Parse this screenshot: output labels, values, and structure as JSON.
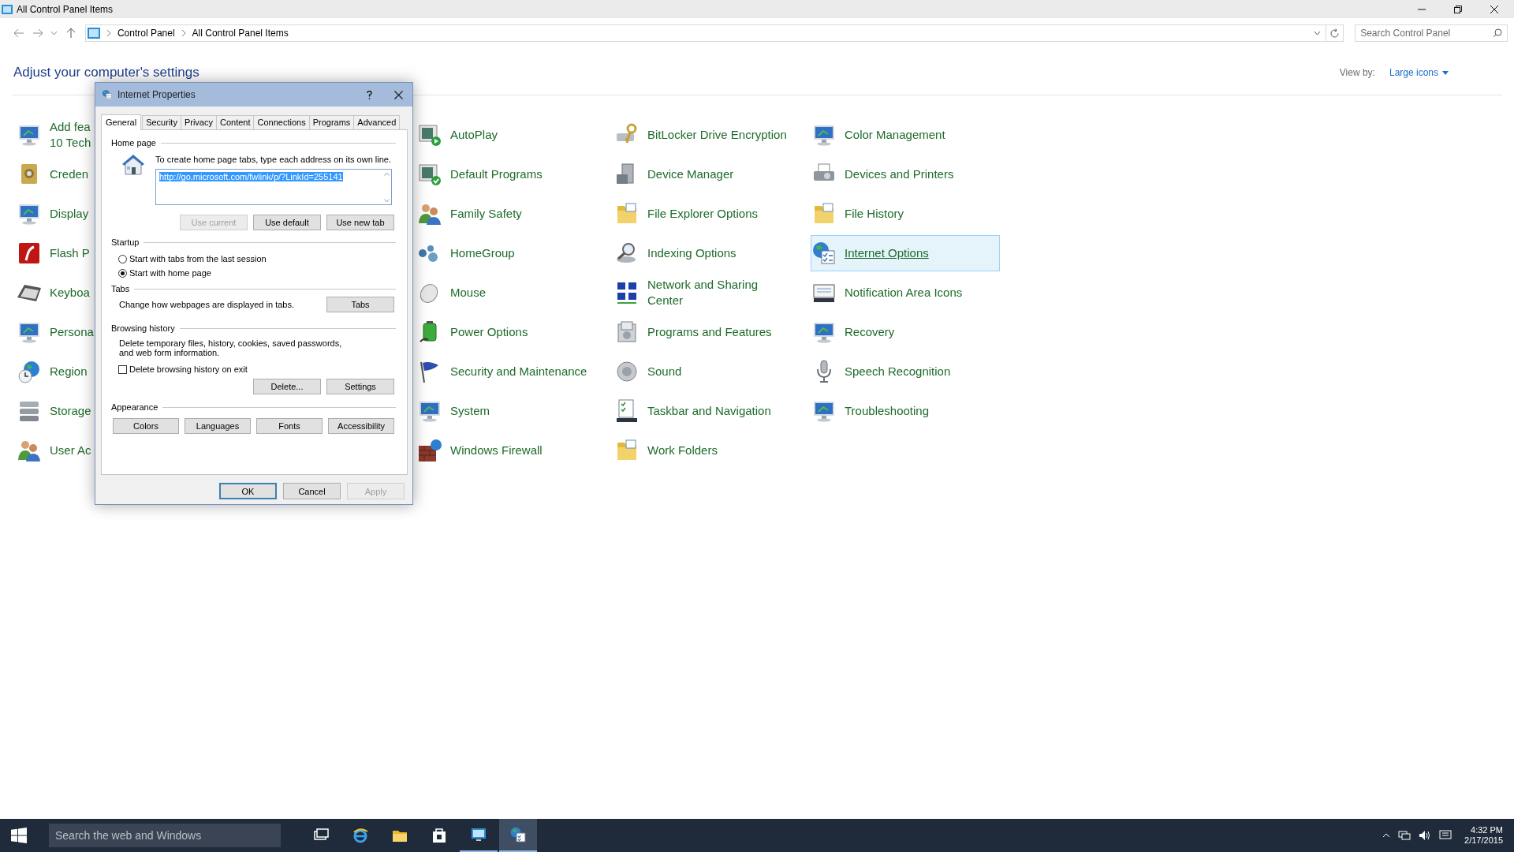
{
  "window": {
    "title": "All Control Panel Items"
  },
  "navigation": {
    "breadcrumb": [
      "Control Panel",
      "All Control Panel Items"
    ],
    "search": {
      "placeholder": "Search Control Panel"
    }
  },
  "heading": "Adjust your computer's settings",
  "view_by": {
    "label": "View by:",
    "value": "Large icons"
  },
  "columns": [
    {
      "items": [
        {
          "label": "Add fea 10 Tech",
          "selected": false
        },
        {
          "label": "Creden",
          "selected": false
        },
        {
          "label": "Display",
          "selected": false
        },
        {
          "label": "Flash P",
          "selected": false
        },
        {
          "label": "Keyboa",
          "selected": false
        },
        {
          "label": "Persona",
          "selected": false
        },
        {
          "label": "Region",
          "selected": false
        },
        {
          "label": "Storage",
          "selected": false
        },
        {
          "label": "User Ac",
          "selected": false
        }
      ]
    },
    {
      "items": [
        {
          "label": "AutoPlay",
          "selected": false
        },
        {
          "label": "Default Programs",
          "selected": false
        },
        {
          "label": "Family Safety",
          "selected": false
        },
        {
          "label": "HomeGroup",
          "selected": false
        },
        {
          "label": "Mouse",
          "selected": false
        },
        {
          "label": "Power Options",
          "selected": false
        },
        {
          "label": "Security and Maintenance",
          "selected": false
        },
        {
          "label": "System",
          "selected": false
        },
        {
          "label": "Windows Firewall",
          "selected": false
        }
      ]
    },
    {
      "items": [
        {
          "label": "BitLocker Drive Encryption",
          "selected": false
        },
        {
          "label": "Device Manager",
          "selected": false
        },
        {
          "label": "File Explorer Options",
          "selected": false
        },
        {
          "label": "Indexing Options",
          "selected": false
        },
        {
          "label": "Network and Sharing Center",
          "selected": false
        },
        {
          "label": "Programs and Features",
          "selected": false
        },
        {
          "label": "Sound",
          "selected": false
        },
        {
          "label": "Taskbar and Navigation",
          "selected": false
        },
        {
          "label": "Work Folders",
          "selected": false
        }
      ]
    },
    {
      "items": [
        {
          "label": "Color Management",
          "selected": false
        },
        {
          "label": "Devices and Printers",
          "selected": false
        },
        {
          "label": "File History",
          "selected": false
        },
        {
          "label": "Internet Options",
          "selected": true
        },
        {
          "label": "Notification Area Icons",
          "selected": false
        },
        {
          "label": "Recovery",
          "selected": false
        },
        {
          "label": "Speech Recognition",
          "selected": false
        },
        {
          "label": "Troubleshooting",
          "selected": false
        }
      ]
    }
  ],
  "dialog": {
    "title": "Internet Properties",
    "tabs": [
      {
        "label": "General",
        "selected": true
      },
      {
        "label": "Security",
        "selected": false
      },
      {
        "label": "Privacy",
        "selected": false
      },
      {
        "label": "Content",
        "selected": false
      },
      {
        "label": "Connections",
        "selected": false
      },
      {
        "label": "Programs",
        "selected": false
      },
      {
        "label": "Advanced",
        "selected": false
      }
    ],
    "home_page": {
      "heading": "Home page",
      "instruction": "To create home page tabs, type each address on its own line.",
      "value": "http://go.microsoft.com/fwlink/p/?LinkId=255141",
      "value_selected": true,
      "buttons": [
        {
          "label": "Use current",
          "disabled": true
        },
        {
          "label": "Use default",
          "disabled": false
        },
        {
          "label": "Use new tab",
          "disabled": false
        }
      ]
    },
    "startup": {
      "heading": "Startup",
      "options": [
        {
          "label": "Start with tabs from the last session",
          "selected": false
        },
        {
          "label": "Start with home page",
          "selected": true
        }
      ]
    },
    "tabs_section": {
      "heading": "Tabs",
      "description": "Change how webpages are displayed in tabs.",
      "button": "Tabs"
    },
    "browsing_history": {
      "heading": "Browsing history",
      "description": "Delete temporary files, history, cookies, saved passwords, and web form information.",
      "checkbox": {
        "label": "Delete browsing history on exit",
        "checked": false
      },
      "buttons": [
        "Delete...",
        "Settings"
      ]
    },
    "appearance": {
      "heading": "Appearance",
      "buttons": [
        "Colors",
        "Languages",
        "Fonts",
        "Accessibility"
      ]
    },
    "footer_buttons": [
      {
        "label": "OK",
        "default": true,
        "disabled": false
      },
      {
        "label": "Cancel",
        "default": false,
        "disabled": false
      },
      {
        "label": "Apply",
        "default": false,
        "disabled": true
      }
    ]
  },
  "taskbar": {
    "search": {
      "placeholder": "Search the web and Windows"
    },
    "apps": [
      {
        "open": false,
        "selected": false
      },
      {
        "open": false,
        "selected": false
      },
      {
        "open": false,
        "selected": false
      },
      {
        "open": false,
        "selected": false
      },
      {
        "open": true,
        "selected": false
      },
      {
        "open": true,
        "selected": true
      }
    ],
    "time": "4:32 PM",
    "date": "2/17/2015"
  }
}
